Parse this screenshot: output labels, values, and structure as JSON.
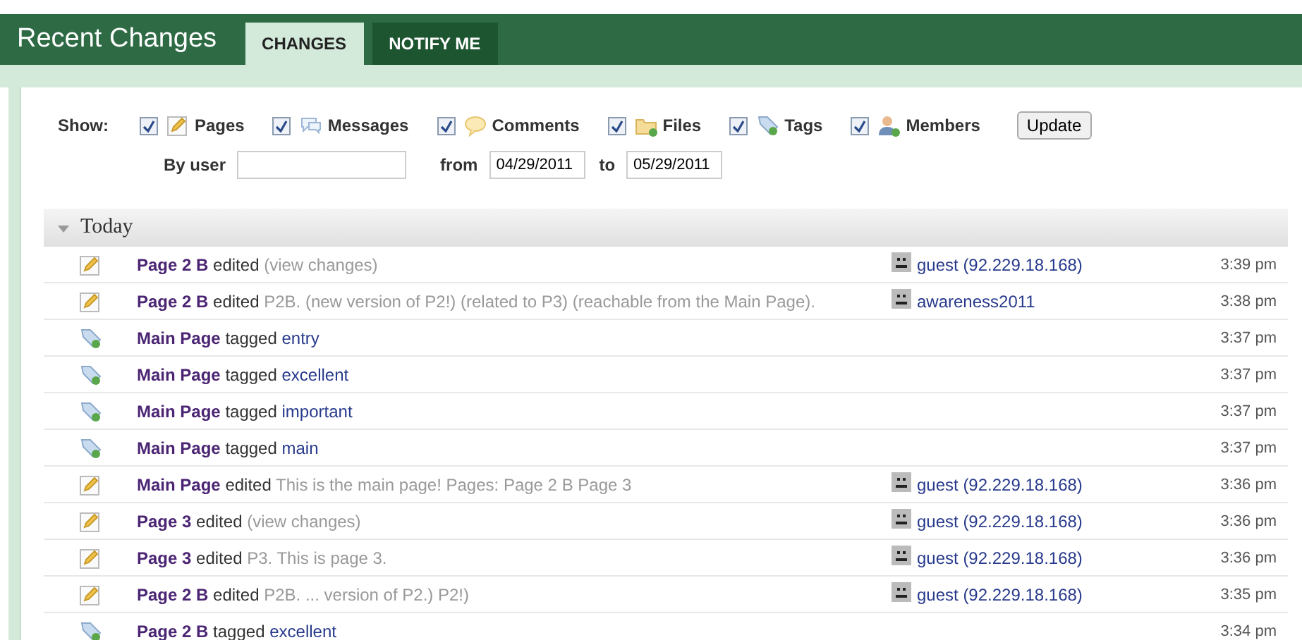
{
  "header": {
    "title": "Recent Changes"
  },
  "tabs": [
    {
      "label": "CHANGES",
      "selected": true
    },
    {
      "label": "NOTIFY ME",
      "selected": false
    }
  ],
  "filters": {
    "label": "Show:",
    "items": [
      {
        "kind": "pages",
        "label": "Pages",
        "checked": true
      },
      {
        "kind": "messages",
        "label": "Messages",
        "checked": true
      },
      {
        "kind": "comments",
        "label": "Comments",
        "checked": true
      },
      {
        "kind": "files",
        "label": "Files",
        "checked": true
      },
      {
        "kind": "tags",
        "label": "Tags",
        "checked": true
      },
      {
        "kind": "members",
        "label": "Members",
        "checked": true
      }
    ],
    "update_button": "Update",
    "user_label": "By user",
    "from_label": "from",
    "from_value": "04/29/2011",
    "to_label": "to",
    "to_value": "05/29/2011"
  },
  "group": {
    "title": "Today",
    "expanded": true,
    "rows": [
      {
        "kind": "edit",
        "page": "Page 2 B",
        "action": "edited",
        "detail": "(view changes)",
        "user": "guest (92.229.18.168)",
        "time": "3:39 pm"
      },
      {
        "kind": "edit",
        "page": "Page 2 B",
        "action": "edited",
        "detail": "P2B. (new version of P2!) (related to P3) (reachable from the Main Page).",
        "user": "awareness2011",
        "time": "3:38 pm"
      },
      {
        "kind": "tag",
        "page": "Main Page",
        "action": "tagged",
        "tag": "entry",
        "time": "3:37 pm"
      },
      {
        "kind": "tag",
        "page": "Main Page",
        "action": "tagged",
        "tag": "excellent",
        "time": "3:37 pm"
      },
      {
        "kind": "tag",
        "page": "Main Page",
        "action": "tagged",
        "tag": "important",
        "time": "3:37 pm"
      },
      {
        "kind": "tag",
        "page": "Main Page",
        "action": "tagged",
        "tag": "main",
        "time": "3:37 pm"
      },
      {
        "kind": "edit",
        "page": "Main Page",
        "action": "edited",
        "detail": "This is the main page! Pages: Page 2 B Page 3",
        "user": "guest (92.229.18.168)",
        "time": "3:36 pm"
      },
      {
        "kind": "edit",
        "page": "Page 3",
        "action": "edited",
        "detail": "(view changes)",
        "user": "guest (92.229.18.168)",
        "time": "3:36 pm"
      },
      {
        "kind": "edit",
        "page": "Page 3",
        "action": "edited",
        "detail": "P3. This is page 3.",
        "user": "guest (92.229.18.168)",
        "time": "3:36 pm"
      },
      {
        "kind": "edit",
        "page": "Page 2 B",
        "action": "edited",
        "detail": "P2B. ... version of P2.) P2!)",
        "user": "guest (92.229.18.168)",
        "time": "3:35 pm"
      },
      {
        "kind": "tag",
        "page": "Page 2 B",
        "action": "tagged",
        "tag": "excellent",
        "time": "3:34 pm"
      }
    ]
  }
}
